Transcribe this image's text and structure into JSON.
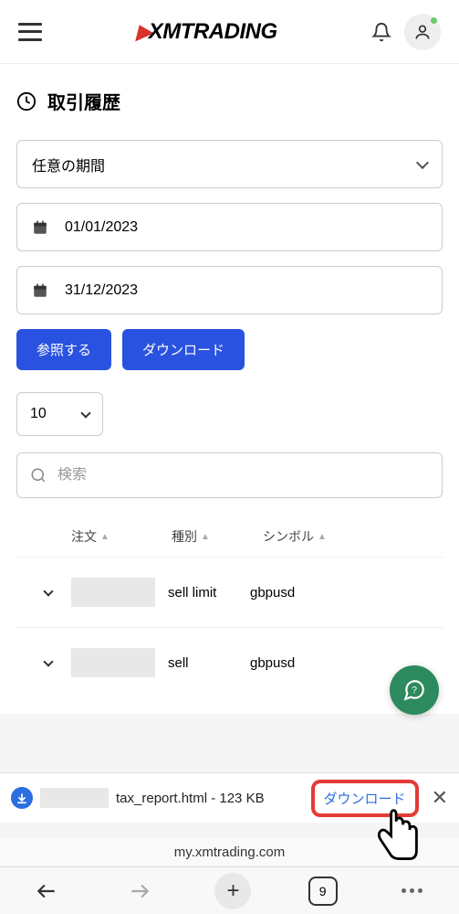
{
  "header": {
    "logo_text": "XMTRADING"
  },
  "page": {
    "title": "取引履歴"
  },
  "filters": {
    "period_label": "任意の期間",
    "date_from": "01/01/2023",
    "date_to": "31/12/2023",
    "browse_btn": "参照する",
    "download_btn": "ダウンロード"
  },
  "table": {
    "page_size": "10",
    "search_placeholder": "検索",
    "columns": {
      "order": "注文",
      "type": "種別",
      "symbol": "シンボル"
    },
    "rows": [
      {
        "type": "sell limit",
        "symbol": "gbpusd"
      },
      {
        "type": "sell",
        "symbol": "gbpusd"
      }
    ]
  },
  "download_bar": {
    "filename_suffix": "tax_report.html - 123 KB",
    "action": "ダウンロード"
  },
  "browser": {
    "url": "my.xmtrading.com",
    "tab_count": "9"
  }
}
